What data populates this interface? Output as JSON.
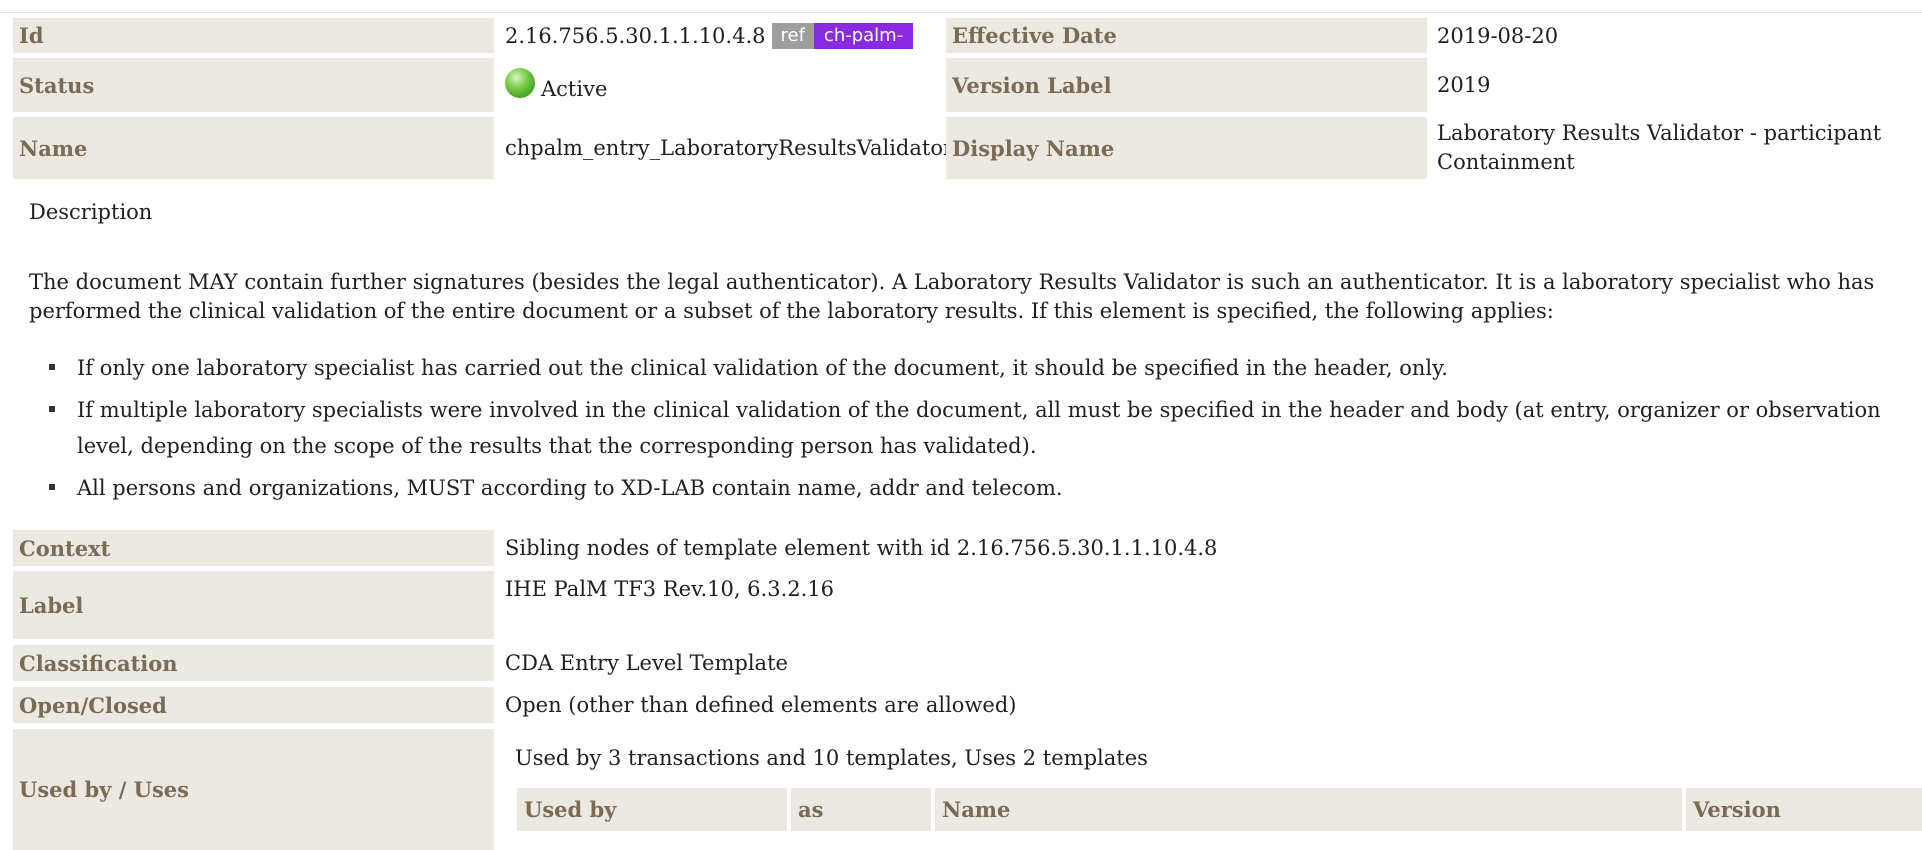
{
  "header": {
    "id_label": "Id",
    "id_value": "2.16.756.5.30.1.1.10.4.8",
    "ref_badge": "ref",
    "prefix_badge": "ch-palm-",
    "effective_date_label": "Effective Date",
    "effective_date_value": "2019-08-20",
    "status_label": "Status",
    "status_value": "Active",
    "status_color": "#5cb82e",
    "version_label_label": "Version Label",
    "version_label_value": "2019",
    "name_label": "Name",
    "name_value": "chpalm_entry_LaboratoryResultsValidator",
    "display_name_label": "Display Name",
    "display_name_value": "Laboratory Results Validator - participant Containment"
  },
  "description": {
    "title": "Description",
    "text": "The document MAY contain further signatures (besides the legal authenticator). A Laboratory Results Validator is such an authenticator. It is a laboratory specialist who has performed the clinical validation of the entire document or a subset of the laboratory results. If this element is specified, the following applies:",
    "bullets": [
      "If only one laboratory specialist has carried out the clinical validation of the document, it should be specified in the header, only.",
      "If multiple laboratory specialists were involved in the clinical validation of the document, all must be specified in the header and body (at entry, organizer or observation level, depending on the scope of the results that the corresponding person has validated).",
      "All persons and organizations, MUST according to XD-LAB contain name, addr and telecom."
    ]
  },
  "details": {
    "context_label": "Context",
    "context_value": "Sibling nodes of template element with id 2.16.756.5.30.1.1.10.4.8",
    "label_label": "Label",
    "label_value": "IHE PalM TF3 Rev.10, 6.3.2.16",
    "classification_label": "Classification",
    "classification_value": "CDA Entry Level Template",
    "open_closed_label": "Open/Closed",
    "open_closed_value": "Open (other than defined elements are allowed)",
    "used_by_label": "Used by / Uses",
    "used_by_summary": "Used by 3 transactions and 10 templates, Uses 2 templates"
  },
  "used_by_table": {
    "columns": [
      "Used by",
      "as",
      "Name",
      "Version"
    ]
  }
}
